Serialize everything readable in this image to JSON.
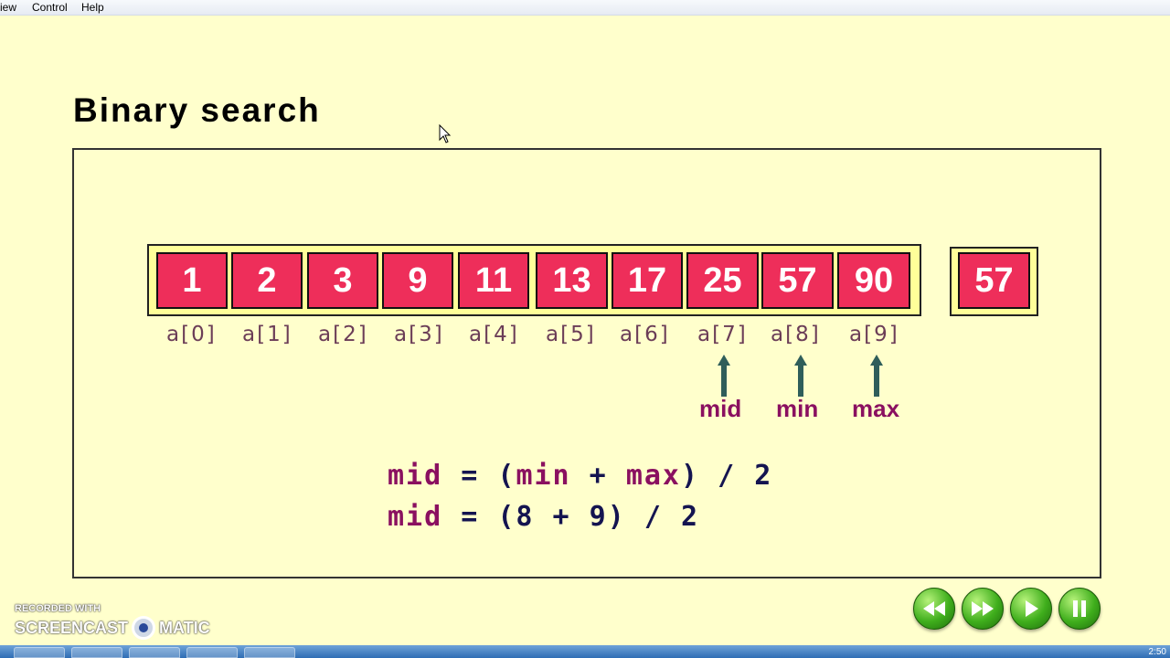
{
  "menu": {
    "view": "iew",
    "control": "Control",
    "help": "Help"
  },
  "slide": {
    "title": "Binary search"
  },
  "array": {
    "values": [
      "1",
      "2",
      "3",
      "9",
      "11",
      "13",
      "17",
      "25",
      "57",
      "90"
    ],
    "indices": [
      "a[0]",
      "a[1]",
      "a[2]",
      "a[3]",
      "a[4]",
      "a[5]",
      "a[6]",
      "a[7]",
      "a[8]",
      "a[9]"
    ]
  },
  "search_key": "57",
  "pointers": {
    "mid": "mid",
    "min": "min",
    "max": "max"
  },
  "formula1": {
    "mid": "mid",
    "eq": " = (",
    "min": "min",
    "plus": " + ",
    "max": "max",
    "end": ") / 2"
  },
  "formula2": {
    "mid": "mid",
    "rest": " = (8 + 9) / 2"
  },
  "watermark": {
    "line1": "RECORDED WITH",
    "line2a": "SCREENCAST",
    "line2b": "MATIC"
  },
  "clock": "2:50",
  "colors": {
    "background": "#ffffcc",
    "cell": "#ee2e5a",
    "frame": "#ffff99",
    "keyword": "#8a1060",
    "operator": "#141450",
    "arrow": "#2f5e5a"
  },
  "icons": [
    "rewind-icon",
    "fast-forward-icon",
    "play-icon",
    "pause-icon",
    "cursor-icon"
  ]
}
